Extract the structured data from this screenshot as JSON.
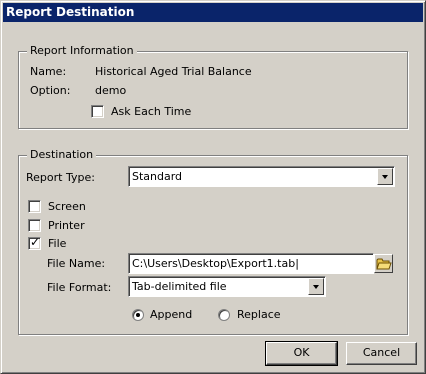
{
  "window": {
    "title": "Report Destination"
  },
  "report_info": {
    "legend": "Report Information",
    "name_label": "Name:",
    "name_value": "Historical Aged Trial Balance",
    "option_label": "Option:",
    "option_value": "demo",
    "ask_each_time_label": "Ask Each Time",
    "ask_each_time_checked": false
  },
  "destination": {
    "legend": "Destination",
    "report_type_label": "Report Type:",
    "report_type_value": "Standard",
    "screen_label": "Screen",
    "screen_checked": false,
    "printer_label": "Printer",
    "printer_checked": false,
    "file_label": "File",
    "file_checked": true,
    "file_name_label": "File Name:",
    "file_name_value": "C:\\Users\\Desktop\\Export1.tab|",
    "file_format_label": "File Format:",
    "file_format_value": "Tab-delimited file",
    "append_label": "Append",
    "replace_label": "Replace",
    "selected_mode": "Append"
  },
  "buttons": {
    "ok": "OK",
    "cancel": "Cancel"
  },
  "icons": {
    "checkmark": "check-mark-icon",
    "folder": "folder-icon",
    "dropdown": "chevron-down-icon"
  },
  "colors": {
    "titlebar": "#0a246a",
    "face": "#d4d0c8",
    "folder": "#e8c44a"
  }
}
